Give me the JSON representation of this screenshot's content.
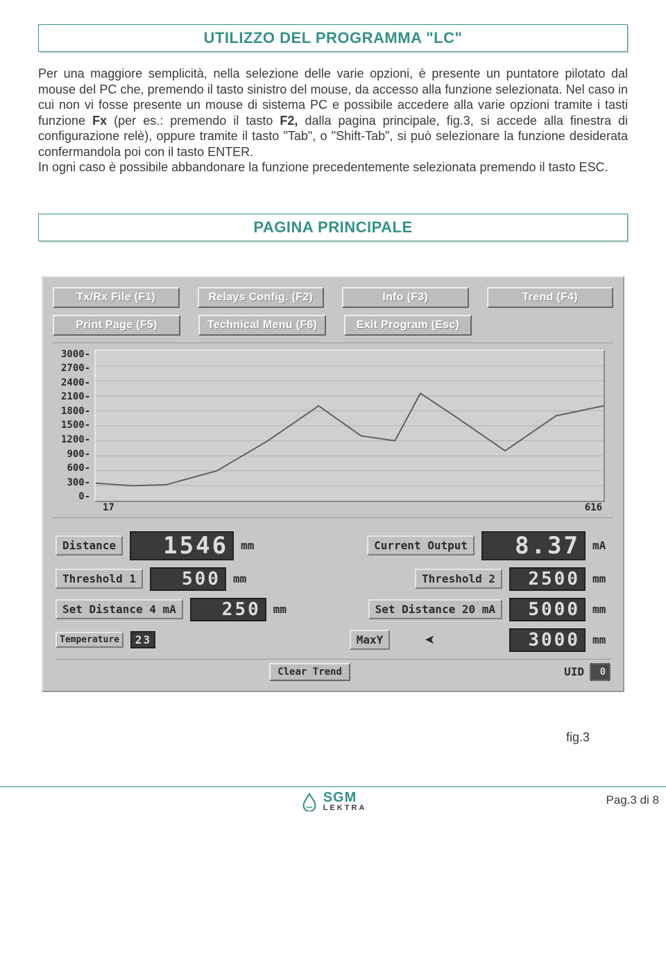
{
  "sections": {
    "title1": "UTILIZZO DEL PROGRAMMA \"LC\"",
    "title2": "PAGINA PRINCIPALE"
  },
  "body": {
    "p1a": "Per una maggiore semplicità, nella selezione delle varie opzioni, è presente un puntatore pilotato dal mouse del PC che, premendo il tasto sinistro del mouse, da accesso alla funzione selezionata. Nel caso in cui non vi fosse presente un mouse di sistema PC e possibile accedere alla varie opzioni tramite i tasti funzione ",
    "p1b": "Fx",
    "p1c": " (per es.: premendo il tasto ",
    "p1d": "F2,",
    "p1e": " dalla pagina principale, fig.3, si accede alla finestra di configurazione relè), oppure tramite il tasto \"Tab\", o \"Shift-Tab\", si può selezionare la funzione desiderata confermandola poi  con il tasto ENTER.",
    "p2": "In ogni caso è possibile abbandonare la funzione precedentemente selezionata premendo il tasto ESC."
  },
  "app": {
    "buttons_row1": [
      "Tx/Rx File (F1)",
      "Relays Config. (F2)",
      "Info (F3)",
      "Trend (F4)"
    ],
    "buttons_row2": [
      "Print Page (F5)",
      "Technical Menu (F6)",
      "Exit Program (Esc)"
    ],
    "x_axis": {
      "min": "17",
      "max": "616"
    },
    "params": {
      "distance_label": "Distance",
      "distance_value": "1546",
      "distance_unit": "mm",
      "current_label": "Current Output",
      "current_value": "8.37",
      "current_unit": "mA",
      "th1_label": "Threshold 1",
      "th1_value": "500",
      "th1_unit": "mm",
      "th2_label": "Threshold 2",
      "th2_value": "2500",
      "th2_unit": "mm",
      "set4_label": "Set Distance 4 mA",
      "set4_value": "250",
      "set4_unit": "mm",
      "set20_label": "Set Distance 20 mA",
      "set20_value": "5000",
      "set20_unit": "mm",
      "temp_label": "Temperature",
      "temp_value": "23",
      "maxy_label": "MaxY",
      "maxy_value": "3000",
      "maxy_unit": "mm",
      "clear_label": "Clear Trend",
      "uid_label": "UID",
      "uid_value": "0"
    }
  },
  "chart_data": {
    "type": "line",
    "title": "",
    "xlabel": "",
    "ylabel": "",
    "ylim": [
      0,
      3000
    ],
    "xlim": [
      17,
      616
    ],
    "y_ticks": [
      3000,
      2700,
      2400,
      2100,
      1800,
      1500,
      1200,
      900,
      600,
      300,
      0
    ],
    "series": [
      {
        "name": "trend",
        "x": [
          17,
          60,
          100,
          160,
          220,
          280,
          330,
          370,
          400,
          440,
          500,
          560,
          616
        ],
        "values": [
          350,
          300,
          320,
          600,
          1200,
          1900,
          1300,
          1200,
          2150,
          1700,
          1000,
          1700,
          1900
        ]
      }
    ]
  },
  "caption": "fig.3",
  "footer": {
    "brand1": "SGM",
    "brand2": "LEKTRA",
    "page": "Pag.3 di 8"
  }
}
